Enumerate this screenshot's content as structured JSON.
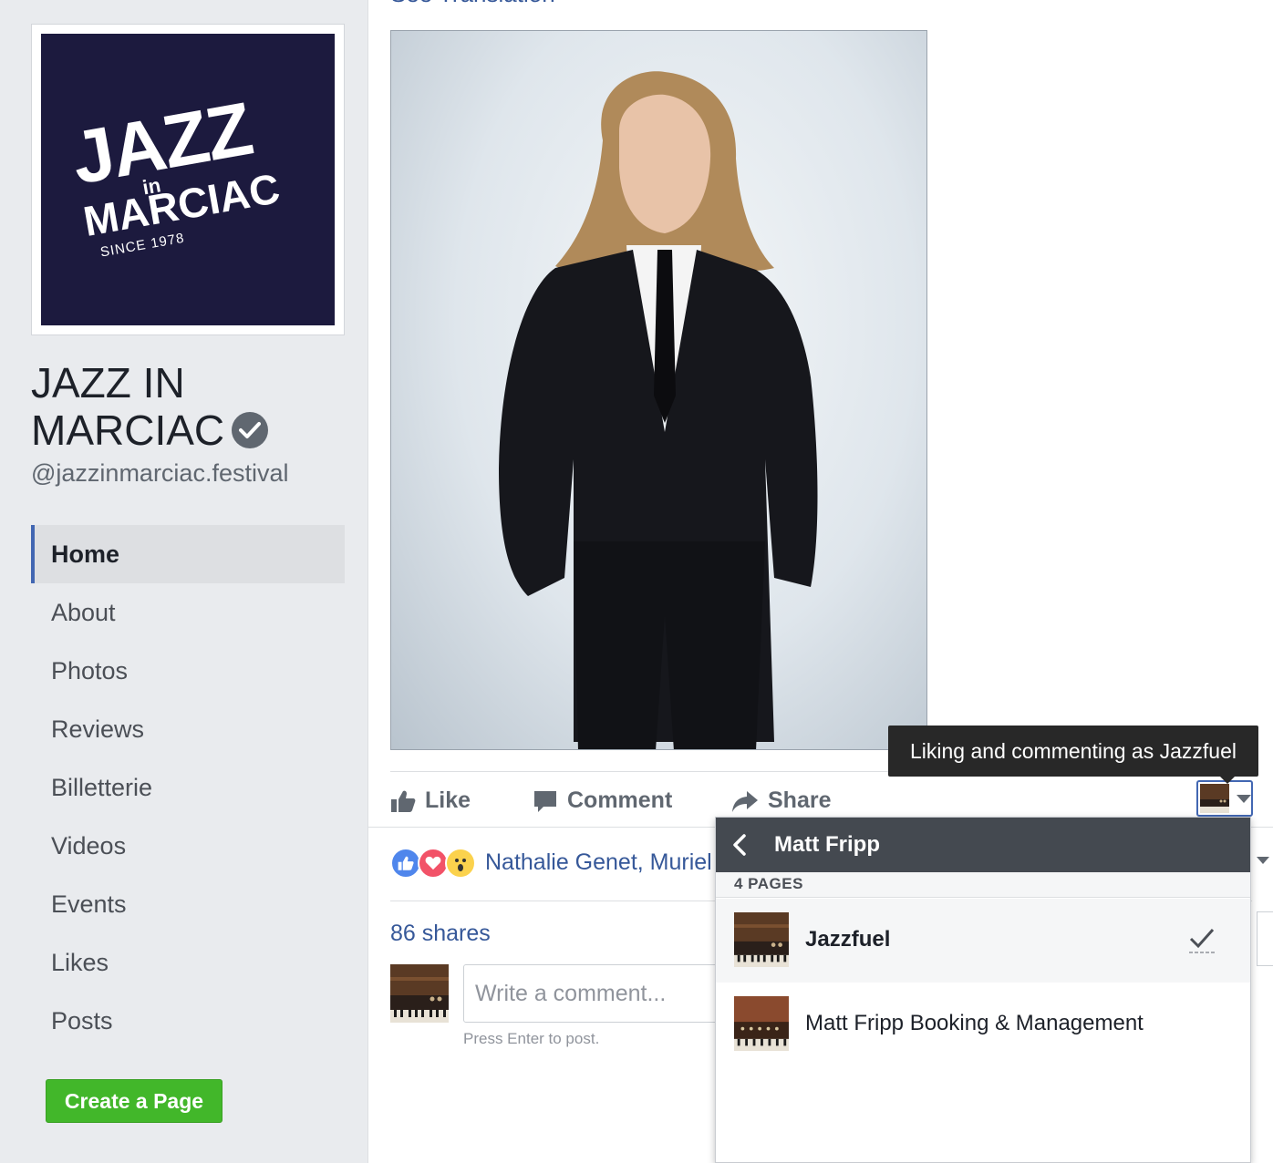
{
  "sidebar": {
    "logo": {
      "line1": "JAZZ",
      "line_in": "in",
      "line2": "MARCIAC",
      "since": "SINCE 1978"
    },
    "page_name_line1": "JAZZ IN",
    "page_name_line2": "MARCIAC",
    "handle": "@jazzinmarciac.festival",
    "nav": [
      {
        "label": "Home",
        "active": true
      },
      {
        "label": "About"
      },
      {
        "label": "Photos"
      },
      {
        "label": "Reviews"
      },
      {
        "label": "Billetterie"
      },
      {
        "label": "Videos"
      },
      {
        "label": "Events"
      },
      {
        "label": "Likes"
      },
      {
        "label": "Posts"
      }
    ],
    "create_page_label": "Create a Page"
  },
  "post": {
    "see_translation": "See Translation",
    "actions": {
      "like": "Like",
      "comment": "Comment",
      "share": "Share"
    },
    "reactions": [
      "like-reaction-icon",
      "love-reaction-icon",
      "wow-reaction-icon"
    ],
    "reaction_names": "Nathalie Genet, Muriel L",
    "shares": "86 shares",
    "comment_placeholder": "Write a comment...",
    "press_enter": "Press Enter to post."
  },
  "tooltip": "Liking and commenting as Jazzfuel",
  "identity_menu": {
    "title": "Matt Fripp",
    "section": "4 PAGES",
    "items": [
      {
        "label": "Jazzfuel",
        "selected": true
      },
      {
        "label": "Matt Fripp Booking & Management",
        "selected": false
      }
    ]
  },
  "colors": {
    "link": "#365899",
    "brand": "#4267b2",
    "create_button": "#42b72a",
    "logo_bg": "#1c1a3e"
  }
}
